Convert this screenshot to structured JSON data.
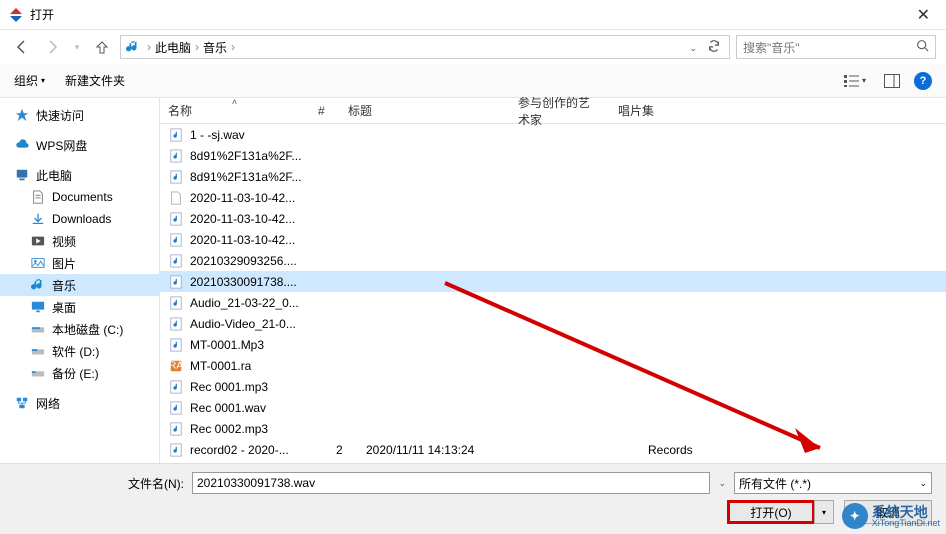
{
  "window": {
    "title": "打开"
  },
  "nav": {
    "breadcrumb": [
      "此电脑",
      "音乐"
    ],
    "search_placeholder": "搜索\"音乐\""
  },
  "toolbar": {
    "organize": "组织",
    "new_folder": "新建文件夹"
  },
  "sidebar": {
    "quick_access": "快速访问",
    "wps": "WPS网盘",
    "this_pc": "此电脑",
    "documents": "Documents",
    "downloads": "Downloads",
    "videos": "视频",
    "pictures": "图片",
    "music": "音乐",
    "desktop": "桌面",
    "local_c": "本地磁盘 (C:)",
    "soft_d": "软件 (D:)",
    "backup_e": "备份 (E:)",
    "network": "网络"
  },
  "columns": {
    "name": "名称",
    "num": "#",
    "title": "标题",
    "artist": "参与创作的艺术家",
    "album": "唱片集"
  },
  "files": [
    {
      "name": "1 - -sj.wav",
      "icon": "audio"
    },
    {
      "name": "8d91%2F131a%2F...",
      "icon": "audio"
    },
    {
      "name": "8d91%2F131a%2F...",
      "icon": "audio"
    },
    {
      "name": "2020-11-03-10-42...",
      "icon": "file"
    },
    {
      "name": "2020-11-03-10-42...",
      "icon": "audio"
    },
    {
      "name": "2020-11-03-10-42...",
      "icon": "audio"
    },
    {
      "name": "20210329093256....",
      "icon": "audio"
    },
    {
      "name": "20210330091738....",
      "icon": "audio",
      "selected": true
    },
    {
      "name": "Audio_21-03-22_0...",
      "icon": "audio"
    },
    {
      "name": "Audio-Video_21-0...",
      "icon": "audio"
    },
    {
      "name": "MT-0001.Mp3",
      "icon": "audio"
    },
    {
      "name": "MT-0001.ra",
      "icon": "ra"
    },
    {
      "name": "Rec 0001.mp3",
      "icon": "audio"
    },
    {
      "name": "Rec 0001.wav",
      "icon": "audio"
    },
    {
      "name": "Rec 0002.mp3",
      "icon": "audio"
    },
    {
      "name": "record02 - 2020-...",
      "icon": "audio",
      "num": "2",
      "title": "2020/11/11 14:13:24",
      "album": "Records"
    }
  ],
  "bottom": {
    "filename_label": "文件名(N):",
    "filename_value": "20210330091738.wav",
    "filter": "所有文件 (*.*)",
    "open_btn": "打开(O)",
    "cancel_btn": "取消"
  },
  "watermark": {
    "title": "系统天地",
    "url": "XiTongTianDi.net"
  }
}
